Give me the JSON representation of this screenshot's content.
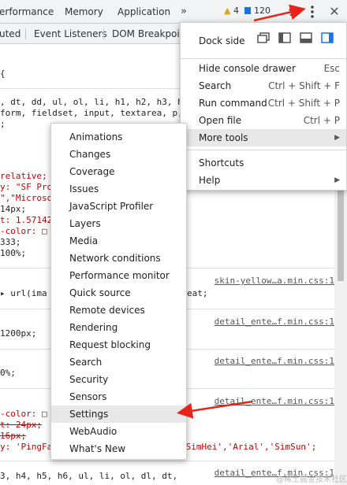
{
  "tabs": [
    "erformance",
    "Memory",
    "Application"
  ],
  "more_tabs": "»",
  "badges": {
    "warnings": "4",
    "issues": "120"
  },
  "subtabs": [
    "uted",
    "Event Listeners",
    "DOM Breakpoin"
  ],
  "code": {
    "l1": "{",
    "l2": ", dt, dd, ul, ol, li, h1, h2, h3, h",
    "l3": "form, fieldset, input, textarea, p,",
    "l4": ";",
    "l5": "",
    "l6": "relative;",
    "l7": "y: \"SF Pro",
    "l8": "\",\"Microso",
    "l9": " 14px;",
    "l10": "t: 1.57142",
    "l11": "-color: □",
    "l12": "333;",
    "l13": "    100%;",
    "l14": "▸ url(ima",
    "l14b": "eat;",
    "l15": " 1200px;",
    "l16": "0%;",
    "l17": "-color: □",
    "l18": "t: 24px;",
    "l19": "16px;",
    "l20": "y: 'PingFa",
    "l20b": "'SimHei','Arial','SimSun';",
    "l21": "3, h4, h5, h6, ul, li, ol, dl, dt,"
  },
  "sources": {
    "s1": "skin-yellow…a.min.css:1",
    "s2": "detail_ente…f.min.css:1",
    "s3": "detail_ente…f.min.css:1",
    "s4": "detail_ente…f.min.css:1",
    "s5": "detail_ente…f.min.css:1"
  },
  "main_menu": {
    "dock_side": "Dock side",
    "items": [
      {
        "label": "Hide console drawer",
        "shortcut": "Esc"
      },
      {
        "label": "Search",
        "shortcut": "Ctrl + Shift + F"
      },
      {
        "label": "Run command",
        "shortcut": "Ctrl + Shift + P"
      },
      {
        "label": "Open file",
        "shortcut": "Ctrl + P"
      },
      {
        "label": "More tools",
        "shortcut": ""
      }
    ],
    "items2": [
      {
        "label": "Shortcuts"
      },
      {
        "label": "Help"
      }
    ]
  },
  "more_tools": [
    "Animations",
    "Changes",
    "Coverage",
    "Issues",
    "JavaScript Profiler",
    "Layers",
    "Media",
    "Network conditions",
    "Performance monitor",
    "Quick source",
    "Remote devices",
    "Rendering",
    "Request blocking",
    "Search",
    "Security",
    "Sensors",
    "Settings",
    "WebAudio",
    "What's New"
  ],
  "watermark": "@稀土掘金技术社区",
  "colors": {
    "accent": "#1a73e8",
    "annotation": "#e8231a"
  }
}
